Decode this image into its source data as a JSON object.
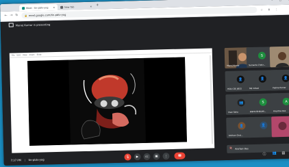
{
  "browser": {
    "tabs": [
      {
        "label": "Meet - tin-pbtv-yog"
      },
      {
        "label": "New Tab"
      }
    ],
    "new_tab_label": "+",
    "window_controls": "– ▢ ✕",
    "url": "meet.google.com/tin-pbtv-yog",
    "extension_icons": "☆ ⬇ ⋮"
  },
  "meet": {
    "presenting_text": "Manoj Kumar is presenting",
    "presentation_toolbar": [
      "File",
      "Edit",
      "View",
      "Insert",
      "Slide"
    ],
    "participants": [
      {
        "name": "Manoj Kumar",
        "initial": "",
        "color": "#3c4043",
        "type": "camera"
      },
      {
        "name": "Sumanta Chakr...",
        "initial": "S",
        "color": "#1e8e3e",
        "type": "avatar"
      },
      {
        "name": "",
        "initial": "",
        "color": "#3c4043",
        "type": "camera"
      },
      {
        "name": "HOD CSE JIECE",
        "initial": "",
        "color": "#3c4043",
        "type": "photo"
      },
      {
        "name": "Md Irshad",
        "initial": "",
        "color": "#3c4043",
        "type": "photo"
      },
      {
        "name": "Padma Kumar",
        "initial": "",
        "color": "#3c4043",
        "type": "photo"
      },
      {
        "name": "Iman Saha",
        "initial": "",
        "color": "#3c4043",
        "type": "photo"
      },
      {
        "name": "BISHU BHAUMI...",
        "initial": "S",
        "color": "#1e8e3e",
        "type": "avatar"
      },
      {
        "name": "Anushna Das",
        "initial": "A",
        "color": "#1e8e3e",
        "type": "avatar"
      },
      {
        "name": "Anirban Chat...",
        "initial": "",
        "color": "#3c4043",
        "type": "photo"
      },
      {
        "name": "",
        "initial": "",
        "color": "#3c4043",
        "type": "photo"
      },
      {
        "name": "",
        "initial": "",
        "color": "#3c4043",
        "type": "camera"
      }
    ],
    "self_name": "Anirban Das"
  },
  "bottom": {
    "time": "7:37 PM",
    "separator": "|",
    "meeting_code": "tin-pbtv-yog",
    "controls": {
      "mic": "🎙",
      "camera": "▶",
      "captions": "CC",
      "present": "▣",
      "more": "⋮",
      "end_call": "☎"
    },
    "right_icons": {
      "info": "ⓘ",
      "people": "👥",
      "chat": "▤"
    }
  }
}
